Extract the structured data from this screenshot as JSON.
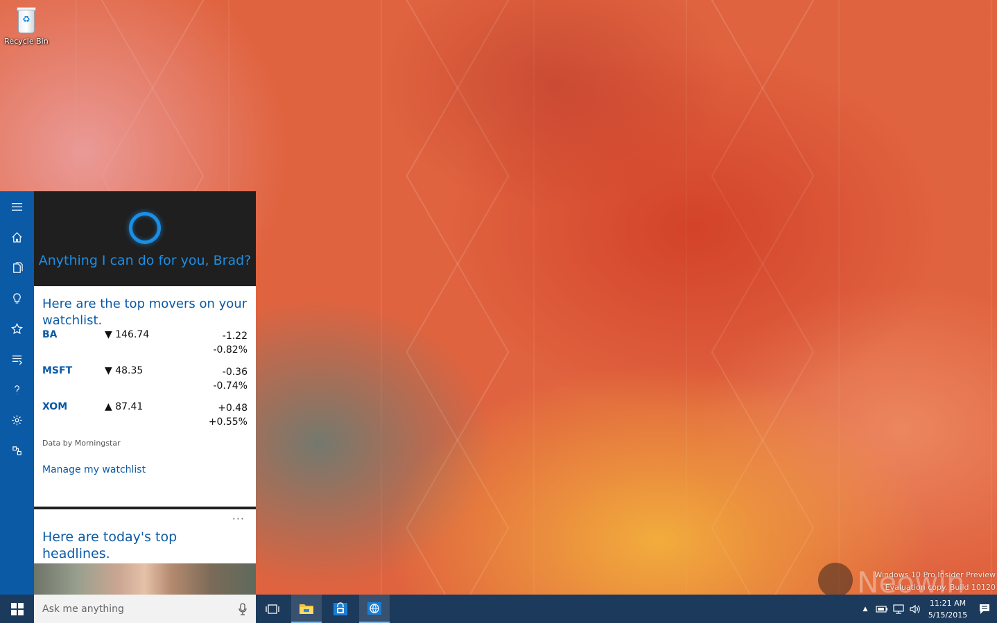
{
  "desktop": {
    "icons": [
      {
        "label": "Recycle Bin",
        "icon": "recycle-bin-icon"
      }
    ],
    "watermark": {
      "line1": "Windows 10 Pro Insider Preview",
      "line2": "Evaluation copy. Build 10120",
      "brand": "Neowin"
    }
  },
  "cortana": {
    "rail": [
      "hamburger-menu-icon",
      "home-icon",
      "notebook-icon",
      "lightbulb-icon",
      "star-icon",
      "feed-icon",
      "help-icon",
      "gear-icon",
      "feedback-icon"
    ],
    "greeting": "Anything I can do for you, Brad?",
    "watchlist_card": {
      "title": "Here are the top movers on your watchlist.",
      "stocks": [
        {
          "symbol": "BA",
          "arrow": "▼",
          "price": "146.74",
          "change": "-1.22",
          "percent": "-0.82%"
        },
        {
          "symbol": "MSFT",
          "arrow": "▼",
          "price": "48.35",
          "change": "-0.36",
          "percent": "-0.74%"
        },
        {
          "symbol": "XOM",
          "arrow": "▲",
          "price": "87.41",
          "change": "+0.48",
          "percent": "+0.55%"
        }
      ],
      "credit": "Data by Morningstar",
      "manage_link": "Manage my watchlist"
    },
    "headlines_card": {
      "more": "···",
      "title": "Here are today's top headlines."
    }
  },
  "taskbar": {
    "search_placeholder": "Ask me anything",
    "pinned": [
      "task-view-icon",
      "file-explorer-icon",
      "store-icon",
      "browser-icon"
    ],
    "tray": {
      "chevron": "▲",
      "time": "11:21 AM",
      "date": "5/15/2015"
    },
    "colors": {
      "taskbar": "#1c3a5c",
      "accent": "#0a5aa6",
      "cortana_ring": "#1b8fe6"
    }
  }
}
